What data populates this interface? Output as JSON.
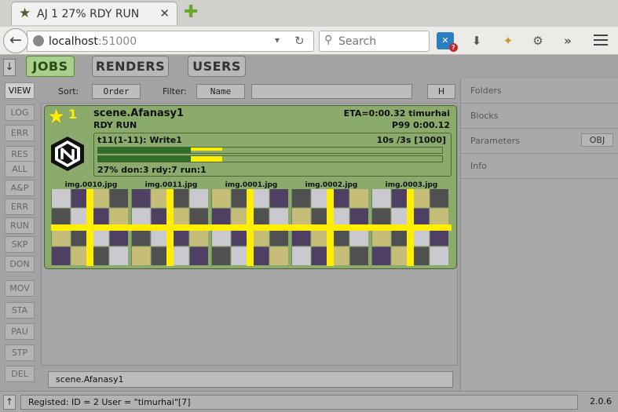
{
  "browser": {
    "tab_title": "AJ 1 27% RDY RUN",
    "tab_close": "✕",
    "new_tab": "✚",
    "back_icon": "←",
    "url_host": "localhost",
    "url_port": ":51000",
    "search_placeholder": "Search",
    "toolbar_icons": [
      "download-icon",
      "extension-icon",
      "addon-icon",
      "overflow-icon",
      "menu-icon"
    ]
  },
  "app": {
    "arrow_down": "↓",
    "arrow_up": "↑",
    "nav": [
      "JOBS",
      "RENDERS",
      "USERS"
    ],
    "active_nav": "JOBS",
    "side_buttons": [
      "VIEW",
      "LOG",
      "ERR",
      "RES",
      "ALL",
      "A&P",
      "ERR",
      "RUN",
      "SKP",
      "DON",
      "MOV",
      "STA",
      "PAU",
      "STP",
      "DEL"
    ],
    "sort_label": "Sort:",
    "sort_value": "Order",
    "filter_label": "Filter:",
    "filter_value": "Name",
    "filter_text": "",
    "h_button": "H",
    "job": {
      "priority_star": "★",
      "number": "1",
      "name": "scene.Afanasy1",
      "state": "RDY RUN",
      "eta": "ETA=0:00.32 timurhai",
      "priority": "P99 0:00.12",
      "block": {
        "name": "t11(1-11): Write1",
        "info": "10s /3s [1000]",
        "stats": "27% don:3 rdy:7 run:1",
        "done_fraction": 0.27,
        "running_fraction": 0.09
      },
      "thumbnails": [
        "img.0010.jpg",
        "img.0011.jpg",
        "img.0001.jpg",
        "img.0002.jpg",
        "img.0003.jpg"
      ]
    },
    "selected_job": "scene.Afanasy1",
    "right_panel": [
      "Folders",
      "Blocks",
      "Parameters",
      "Info"
    ],
    "obj_button": "OBJ",
    "status_text": "Registed: ID = 2 User = \"timurhai\"[7]",
    "version": "2.0.6"
  },
  "colors": {
    "job_bg": "#8aab6c",
    "progress_done": "#2e6d2a",
    "progress_running": "#ffee00",
    "active_tab": "#a9cf8c"
  }
}
